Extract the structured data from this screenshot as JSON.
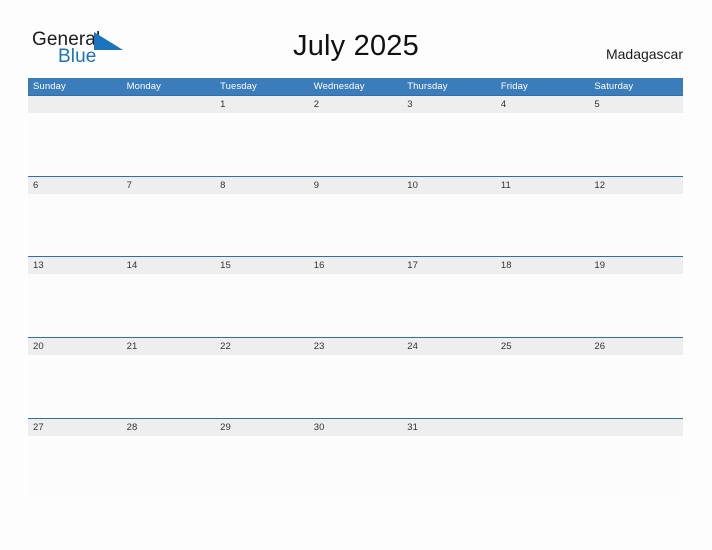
{
  "brand": {
    "word_one": "General",
    "word_two": "Blue",
    "flag_icon": "blue-triangle-flag-icon",
    "accent_color": "#1b74bd"
  },
  "header": {
    "title": "July 2025",
    "country": "Madagascar"
  },
  "theme": {
    "header_blue": "#3b7cbb",
    "row_border_blue": "#2f6fb0",
    "day_band_gray": "#eeeeee",
    "page_background": "#fdfdfd",
    "cell_background": "#fcfcfc",
    "text_dark": "#333333",
    "text_white": "#ffffff"
  },
  "calendar": {
    "month": "July",
    "year": "2025",
    "weekdays": [
      "Sunday",
      "Monday",
      "Tuesday",
      "Wednesday",
      "Thursday",
      "Friday",
      "Saturday"
    ],
    "weeks": [
      {
        "days": [
          "",
          "",
          "1",
          "2",
          "3",
          "4",
          "5"
        ]
      },
      {
        "days": [
          "6",
          "7",
          "8",
          "9",
          "10",
          "11",
          "12"
        ]
      },
      {
        "days": [
          "13",
          "14",
          "15",
          "16",
          "17",
          "18",
          "19"
        ]
      },
      {
        "days": [
          "20",
          "21",
          "22",
          "23",
          "24",
          "25",
          "26"
        ]
      },
      {
        "days": [
          "27",
          "28",
          "29",
          "30",
          "31",
          "",
          ""
        ]
      }
    ]
  }
}
